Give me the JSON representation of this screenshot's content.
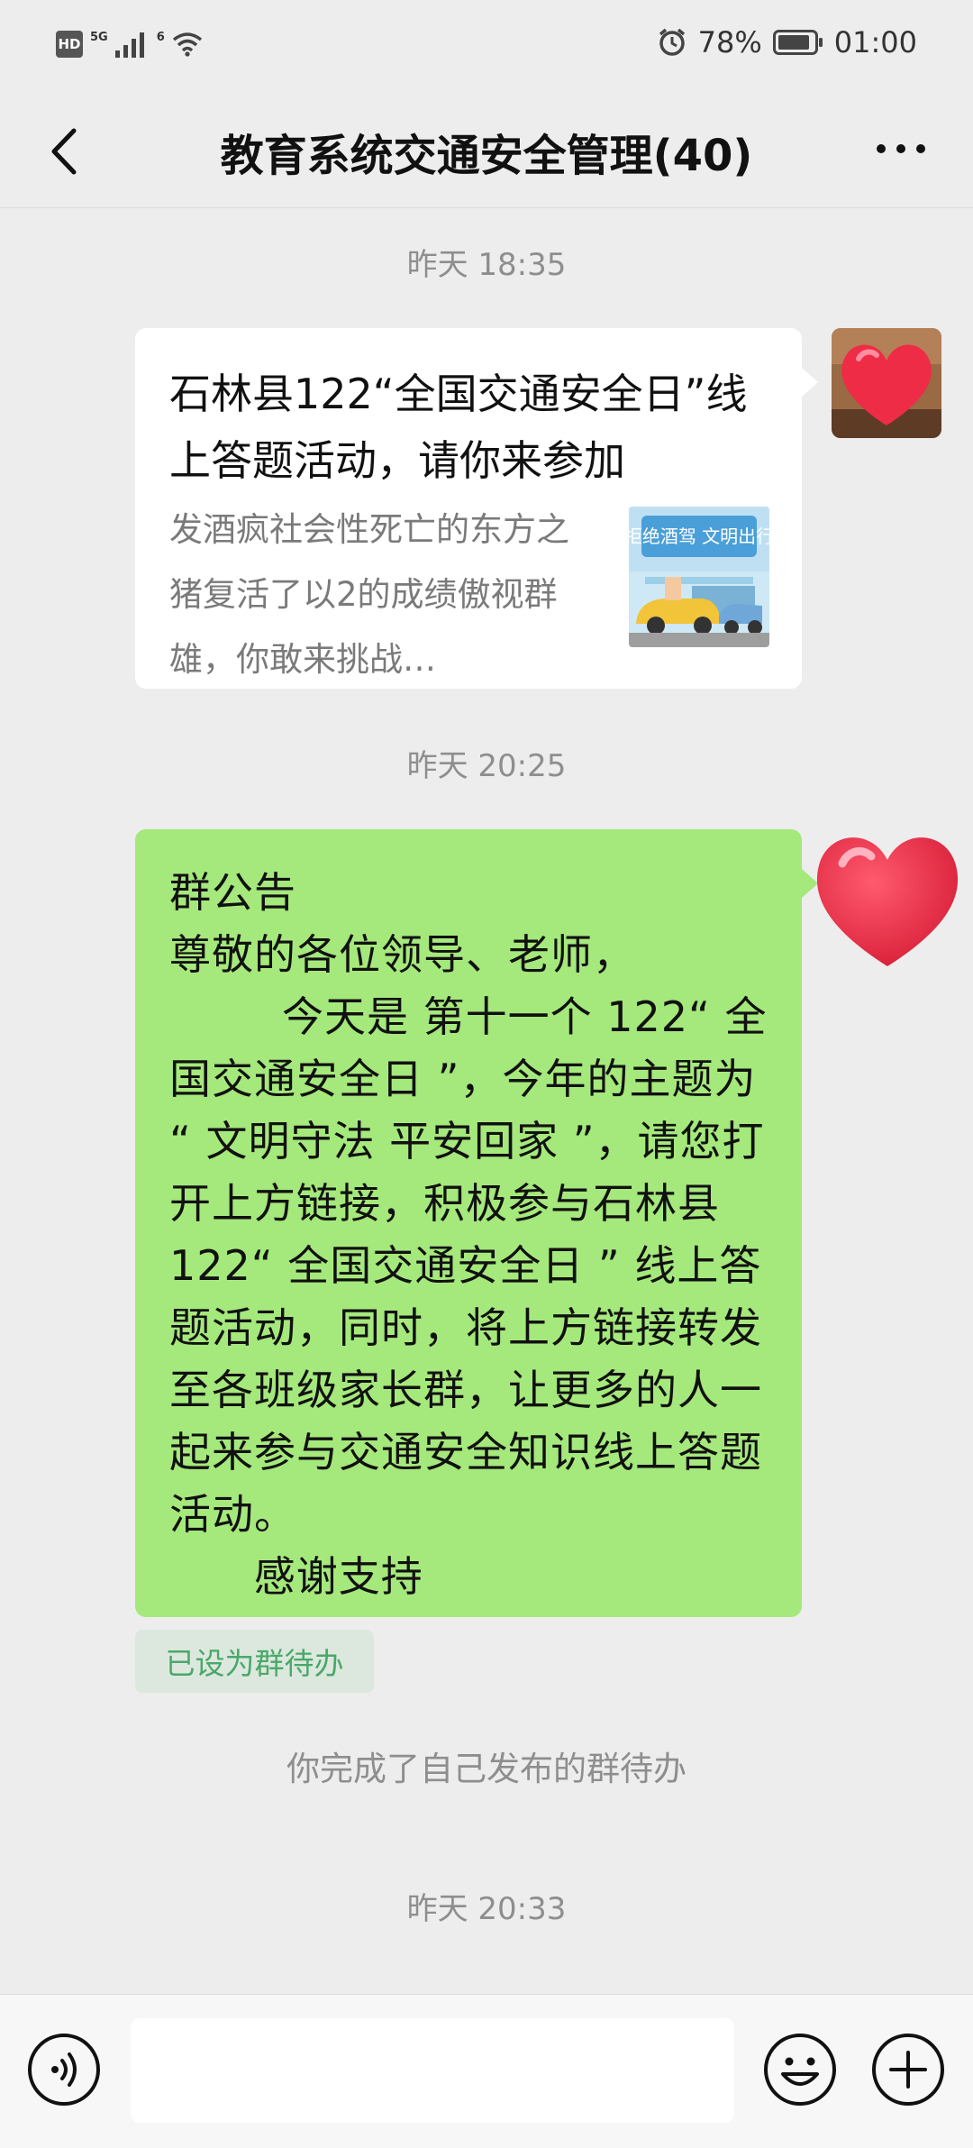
{
  "status_bar": {
    "hd_badge": "HD",
    "net_label": "5G",
    "wifi_label": "6",
    "battery": "78%",
    "time": "01:00"
  },
  "nav": {
    "title": "教育系统交通安全管理(40)"
  },
  "messages": {
    "time1": "昨天 18:35",
    "card_title": "石林县122“全国交通安全日”线上答题活动，请你来参加",
    "card_desc": "发酒疯社会性死亡的东方之猪复活了以2的成绩傲视群雄，你敢来挑战…",
    "card_thumb_text": "拒绝酒驾 文明出行",
    "time2": "昨天 20:25",
    "notice_text": "群公告\n尊敬的各位领导、老师，\n        今天是 第十一个 122“ 全国交通安全日 ”，今年的主题为 “ 文明守法 平安回家 ”，请您打开上方链接，积极参与石林县 122“ 全国交通安全日 ” 线上答题活动，同时，将上方链接转发至各班级家长群，让更多的人一起来参与交通安全知识线上答题活动。\n      感谢支持",
    "todo_chip": "已设为群待办",
    "system_msg": "你完成了自己发布的群待办",
    "time3": "昨天 20:33"
  },
  "input_bar": {
    "placeholder": ""
  },
  "colors": {
    "background": "#ededed",
    "bubble_green": "#a5e87c",
    "chip_text": "#4aa86a",
    "heart_red": "#e8283f"
  }
}
